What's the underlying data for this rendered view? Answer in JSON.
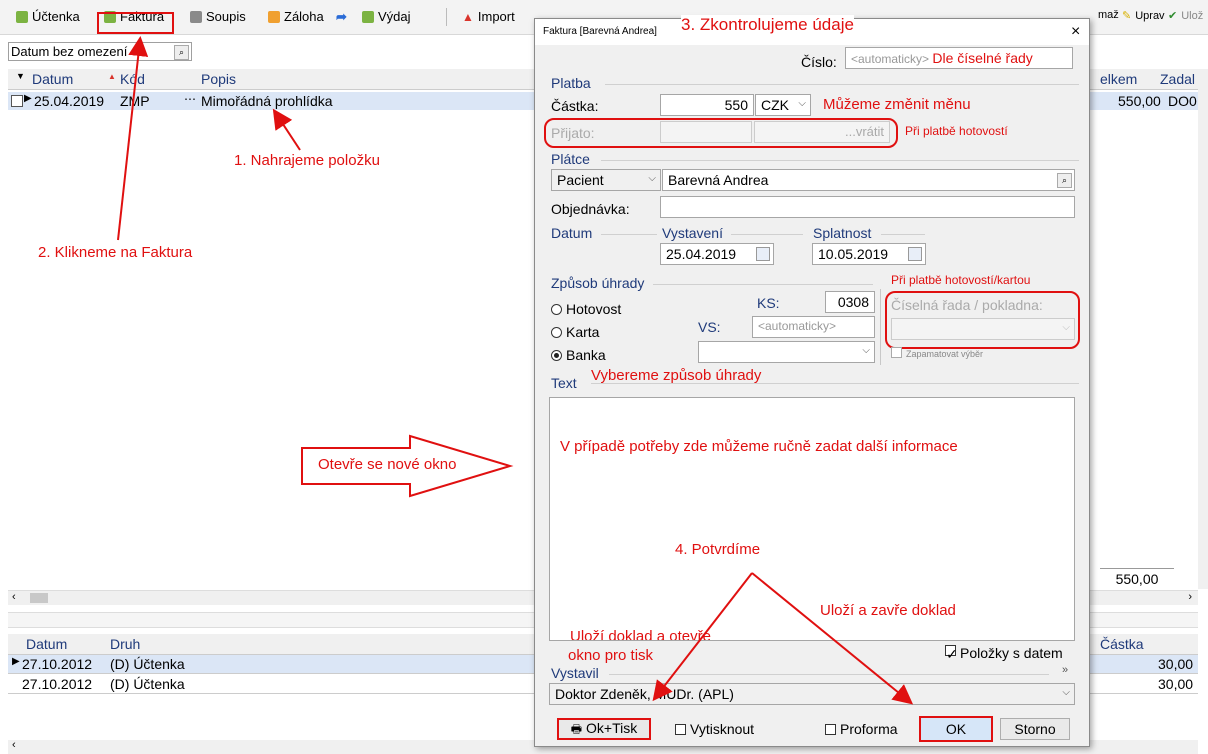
{
  "toolbar": {
    "items": [
      "Účtenka",
      "Faktura",
      "Soupis",
      "Záloha",
      "Výdaj",
      "Import"
    ],
    "right_items": [
      "maž",
      "Uprav",
      "Ulož"
    ]
  },
  "filter": {
    "value": "Datum bez omezení"
  },
  "top_grid": {
    "headers": [
      "Datum",
      "Kód",
      "Popis",
      "elkem",
      "Zadal"
    ],
    "rows": [
      {
        "date": "25.04.2019",
        "code": "ZMP",
        "desc": "Mimořádná prohlídka",
        "total": "550,00",
        "who": "DO0"
      }
    ],
    "sum": "550,00"
  },
  "bottom_grid": {
    "headers": [
      "Datum",
      "Druh",
      "Částka"
    ],
    "rows": [
      {
        "date": "27.10.2012",
        "kind": "(D) Účtenka",
        "amount": "30,00"
      },
      {
        "date": "27.10.2012",
        "kind": "(D) Účtenka",
        "amount": "30,00"
      }
    ]
  },
  "dialog": {
    "title": "Faktura [Barevná Andrea]",
    "close": "×",
    "cislo_label": "Číslo:",
    "cislo_placeholder": "<automaticky>",
    "platba": "Platba",
    "castka_label": "Částka:",
    "castka_value": "550",
    "currency": "CZK",
    "prijato_label": "Přijato:",
    "vratit": "...vrátit",
    "platce": "Plátce",
    "platce_type": "Pacient",
    "platce_name": "Barevná Andrea",
    "objednavka_label": "Objednávka:",
    "datum": "Datum",
    "vystaveni_label": "Vystavení",
    "vystaveni_value": "25.04.2019",
    "splatnost_label": "Splatnost",
    "splatnost_value": "10.05.2019",
    "zpusob": "Způsob úhrady",
    "hotovost": "Hotovost",
    "karta": "Karta",
    "banka": "Banka",
    "ks_label": "KS:",
    "ks_value": "0308",
    "vs_label": "VS:",
    "vs_placeholder": "<automaticky>",
    "ciselna_rada": "Číselná řada / pokladna:",
    "zapamatovat": "Zapamatovat výběr",
    "text": "Text",
    "polozky": "Položky s datem",
    "vystavil": "Vystavil",
    "vystavil_value": "Doktor Zdeněk, MUDr. (APL)",
    "ok_tisk": "Ok+Tisk",
    "vytisknout": "Vytisknout",
    "proforma": "Proforma",
    "ok": "OK",
    "storno": "Storno"
  },
  "annotations": {
    "a1": "1. Nahrajeme položku",
    "a2": "2. Klikneme na Faktura",
    "a3": "3. Zkontrolujeme údaje",
    "a4": "4. Potvrdíme",
    "rada": "Dle číselné řady",
    "mena": "Můžeme změnit měnu",
    "hotovost": "Při platbě hotovostí",
    "hotovost_karta": "Při platbě hotovostí/kartou",
    "zpusob": "Vybereme způsob úhrady",
    "text": "V případě potřeby zde můžeme ručně zadat další informace",
    "okno": "Otevře se nové okno",
    "ok_tisk_1": "Uloží doklad a otevře",
    "ok_tisk_2": "okno pro tisk",
    "ok": "Uloží a zavře doklad"
  },
  "colors": {
    "annotation": "#e01010",
    "selection": "#dbe6f6",
    "section": "#1f3a7a"
  }
}
